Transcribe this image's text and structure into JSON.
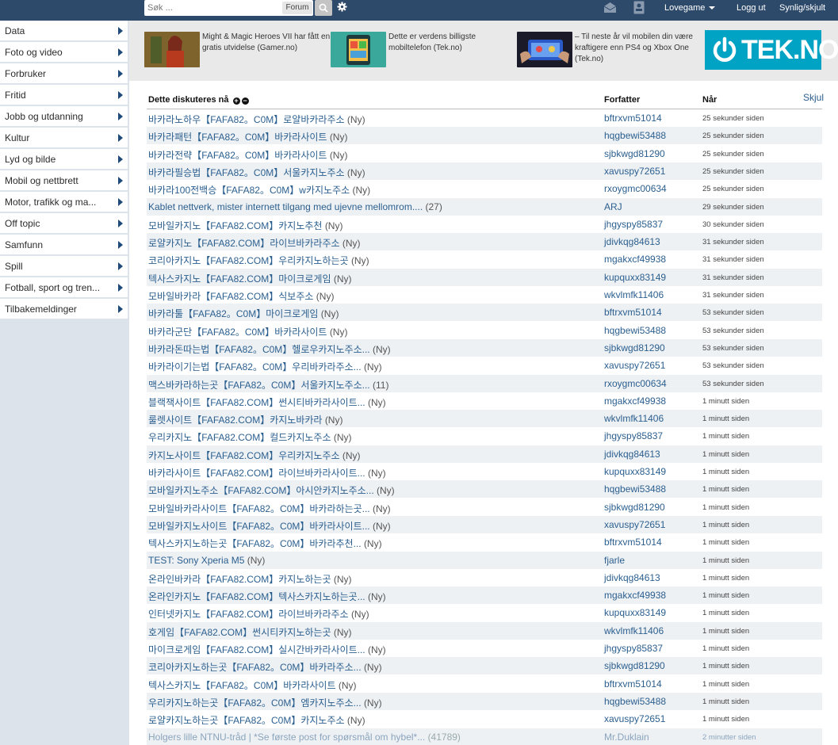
{
  "topbar": {
    "search_placeholder": "Søk ...",
    "search_scope": "Forum",
    "user": "Lovegame",
    "logout": "Logg ut",
    "visibility": "Synlig/skjult"
  },
  "sidebar": {
    "items": [
      {
        "label": "Data"
      },
      {
        "label": "Foto og video"
      },
      {
        "label": "Forbruker"
      },
      {
        "label": "Fritid"
      },
      {
        "label": "Jobb og utdanning"
      },
      {
        "label": "Kultur"
      },
      {
        "label": "Lyd og bilde"
      },
      {
        "label": "Mobil og nettbrett"
      },
      {
        "label": "Motor, trafikk og ma..."
      },
      {
        "label": "Off topic"
      },
      {
        "label": "Samfunn"
      },
      {
        "label": "Spill"
      },
      {
        "label": "Fotball, sport og tren..."
      },
      {
        "label": "Tilbakemeldinger"
      }
    ]
  },
  "news": {
    "items": [
      {
        "text": "Might & Magic Heroes VII har fått en gratis utvidelse (Gamer.no)"
      },
      {
        "text": "Dette er verdens billigste mobiltelefon (Tek.no)"
      },
      {
        "text": "– Til neste år vil mobilen din være kraftigere enn PS4 og Xbox One (Tek.no)"
      }
    ],
    "logo_text": "TEK.NO"
  },
  "table": {
    "header_topic": "Dette diskuteres nå",
    "header_author": "Forfatter",
    "header_when": "Når",
    "hide_label": "Skjul",
    "rows": [
      {
        "title": "바카라노하우【FAFA82。C0M】로얄바카라주소",
        "count": "(Ny)",
        "author": "bftrxvm51014",
        "when": "25 sekunder siden"
      },
      {
        "title": "바카라패턴【FAFA82。C0M】바카라사이트",
        "count": "(Ny)",
        "author": "hqgbewi53488",
        "when": "25 sekunder siden"
      },
      {
        "title": "바카라전략【FAFA82。C0M】바카라사이트",
        "count": "(Ny)",
        "author": "sjbkwgd81290",
        "when": "25 sekunder siden"
      },
      {
        "title": "바카라필승법【FAFA82。C0M】서울카지노주소",
        "count": "(Ny)",
        "author": "xavuspy72651",
        "when": "25 sekunder siden"
      },
      {
        "title": "바카라100전백승【FAFA82。C0M】w카지노주소",
        "count": "(Ny)",
        "author": "rxoygmc00634",
        "when": "25 sekunder siden"
      },
      {
        "title": "Kablet nettverk, mister internett tilgang med ujevne mellomrom....",
        "count": "(27)",
        "author": "ARJ",
        "when": "29 sekunder siden"
      },
      {
        "title": "모바일카지노【FAFA82.COM】카지노추천",
        "count": "(Ny)",
        "author": "jhgyspy85837",
        "when": "30 sekunder siden"
      },
      {
        "title": "로얄카지노【FAFA82.COM】라이브바카라주소",
        "count": "(Ny)",
        "author": "jdivkqg84613",
        "when": "31 sekunder siden"
      },
      {
        "title": "코리아카지노【FAFA82.COM】우리카지노하는곳",
        "count": "(Ny)",
        "author": "mgakxcf49938",
        "when": "31 sekunder siden"
      },
      {
        "title": "텍사스카지노【FAFA82.COM】마이크로게임",
        "count": "(Ny)",
        "author": "kupquxx83149",
        "when": "31 sekunder siden"
      },
      {
        "title": "모바일바카라【FAFA82.COM】식보주소",
        "count": "(Ny)",
        "author": "wkvlmfk11406",
        "when": "31 sekunder siden"
      },
      {
        "title": "바카라툴【FAFA82。C0M】마이크로게임",
        "count": "(Ny)",
        "author": "bftrxvm51014",
        "when": "53 sekunder siden"
      },
      {
        "title": "바카라군단【FAFA82。C0M】바카라사이트",
        "count": "(Ny)",
        "author": "hqgbewi53488",
        "when": "53 sekunder siden"
      },
      {
        "title": "바카라돈따는법【FAFA82。C0M】헬로우카지노주소...",
        "count": "(Ny)",
        "author": "sjbkwgd81290",
        "when": "53 sekunder siden"
      },
      {
        "title": "바카라이기는법【FAFA82。C0M】우리바카라주소...",
        "count": "(Ny)",
        "author": "xavuspy72651",
        "when": "53 sekunder siden"
      },
      {
        "title": "맥스바카라하는곳【FAFA82。C0M】서울카지노주소...",
        "count": "(11)",
        "author": "rxoygmc00634",
        "when": "53 sekunder siden"
      },
      {
        "title": "블랙잭사이트【FAFA82.COM】썬시티바카라사이트...",
        "count": "(Ny)",
        "author": "mgakxcf49938",
        "when": "1 minutt siden"
      },
      {
        "title": "룰렛사이트【FAFA82.COM】카지노바카라",
        "count": "(Ny)",
        "author": "wkvlmfk11406",
        "when": "1 minutt siden"
      },
      {
        "title": "우리카지노【FAFA82.COM】컬드카지노주소",
        "count": "(Ny)",
        "author": "jhgyspy85837",
        "when": "1 minutt siden"
      },
      {
        "title": "카지노사이트【FAFA82.COM】우리카지노주소",
        "count": "(Ny)",
        "author": "jdivkqg84613",
        "when": "1 minutt siden"
      },
      {
        "title": "바카라사이트【FAFA82.COM】라이브바카라사이트...",
        "count": "(Ny)",
        "author": "kupquxx83149",
        "when": "1 minutt siden"
      },
      {
        "title": "모바일카지노주소【FAFA82.COM】아시안카지노주소...",
        "count": "(Ny)",
        "author": "hqgbewi53488",
        "when": "1 minutt siden"
      },
      {
        "title": "모바일바카라사이트【FAFA82。C0M】바카라하는곳...",
        "count": "(Ny)",
        "author": "sjbkwgd81290",
        "when": "1 minutt siden"
      },
      {
        "title": "모바일카지노사이트【FAFA82。C0M】바카라사이트...",
        "count": "(Ny)",
        "author": "xavuspy72651",
        "when": "1 minutt siden"
      },
      {
        "title": "텍사스카지노하는곳【FAFA82。C0M】바카라추천...",
        "count": "(Ny)",
        "author": "bftrxvm51014",
        "when": "1 minutt siden"
      },
      {
        "title": "TEST: Sony Xperia M5",
        "count": "(Ny)",
        "author": "fjarle",
        "when": "1 minutt siden"
      },
      {
        "title": "온라인바카라【FAFA82.COM】카지노하는곳",
        "count": "(Ny)",
        "author": "jdivkqg84613",
        "when": "1 minutt siden"
      },
      {
        "title": "온라인카지노【FAFA82.COM】텍사스카지노하는곳...",
        "count": "(Ny)",
        "author": "mgakxcf49938",
        "when": "1 minutt siden"
      },
      {
        "title": "인터넷카지노【FAFA82.COM】라이브바카라주소",
        "count": "(Ny)",
        "author": "kupquxx83149",
        "when": "1 minutt siden"
      },
      {
        "title": "호게임【FAFA82.COM】썬시티카지노하는곳",
        "count": "(Ny)",
        "author": "wkvlmfk11406",
        "when": "1 minutt siden"
      },
      {
        "title": "마이크로게임【FAFA82.COM】실시간바카라사이트...",
        "count": "(Ny)",
        "author": "jhgyspy85837",
        "when": "1 minutt siden"
      },
      {
        "title": "코리아카지노하는곳【FAFA82。C0M】바카라주소...",
        "count": "(Ny)",
        "author": "sjbkwgd81290",
        "when": "1 minutt siden"
      },
      {
        "title": "텍사스카지노【FAFA82。C0M】바카라사이트",
        "count": "(Ny)",
        "author": "bftrxvm51014",
        "when": "1 minutt siden"
      },
      {
        "title": "우리카지노하는곳【FAFA82。C0M】엠카지노주소...",
        "count": "(Ny)",
        "author": "hqgbewi53488",
        "when": "1 minutt siden"
      },
      {
        "title": "로얄카지노하는곳【FAFA82。C0M】카지노주소",
        "count": "(Ny)",
        "author": "xavuspy72651",
        "when": "1 minutt siden"
      },
      {
        "title": "Holgers lille NTNU-tråd | *Se første post for spørsmål om hybel*...",
        "count": "(41789)",
        "author": "Mr.Duklain",
        "when": "2 minutter siden"
      }
    ]
  }
}
